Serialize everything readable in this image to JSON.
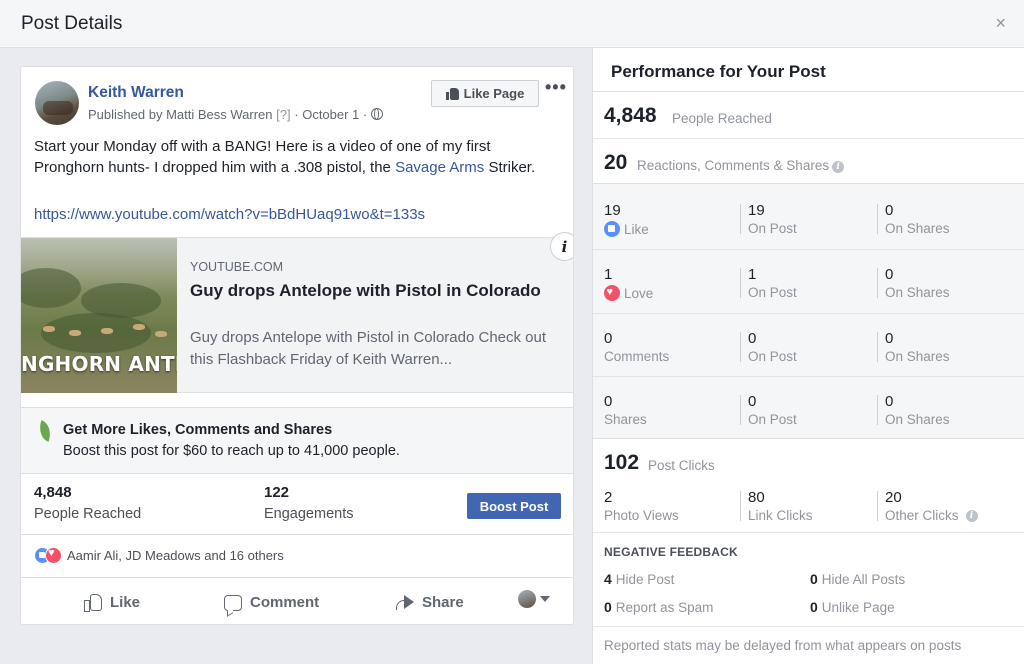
{
  "modal": {
    "title": "Post Details",
    "close_glyph": "×"
  },
  "post": {
    "author": "Keith Warren",
    "published_prefix": "Published by",
    "published_by": "Matti Bess Warren",
    "published_q": "[?]",
    "published_sep": "·",
    "date": "October 1",
    "date_sep": "·",
    "like_page_label": "Like Page",
    "more_glyph": "•••",
    "text_before_link": "Start your Monday off with a BANG! Here is a video of one of my first Pronghorn hunts- I dropped him with a .308 pistol, the ",
    "text_link": "Savage Arms",
    "text_after_link": " Striker.",
    "url": "https://www.youtube.com/watch?v=bBdHUaq91wo&t=133s",
    "preview": {
      "domain": "YOUTUBE.COM",
      "title": "Guy drops Antelope with Pistol in Colorado",
      "description": "Guy drops Antelope with Pistol in Colorado Check out this Flashback Friday of Keith Warren...",
      "image_caption": "NGHORN ANTEL",
      "info_glyph": "i"
    },
    "boost": {
      "title": "Get More Likes, Comments and Shares",
      "subtitle": "Boost this post for $60 to reach up to 41,000 people."
    },
    "stats": {
      "reached_value": "4,848",
      "reached_label": "People Reached",
      "engagements_value": "122",
      "engagements_label": "Engagements",
      "boost_button": "Boost Post"
    },
    "reactions_summary": "Aamir Ali, JD Meadows and 16 others",
    "actions": {
      "like": "Like",
      "comment": "Comment",
      "share": "Share"
    }
  },
  "performance": {
    "title": "Performance for Your Post",
    "reached_value": "4,848",
    "reached_label": "People Reached",
    "reactions_value": "20",
    "reactions_label": "Reactions, Comments & Shares",
    "rows": [
      {
        "c1n": "19",
        "c1l": "Like",
        "c2n": "19",
        "c2l": "On Post",
        "c3n": "0",
        "c3l": "On Shares"
      },
      {
        "c1n": "1",
        "c1l": "Love",
        "c2n": "1",
        "c2l": "On Post",
        "c3n": "0",
        "c3l": "On Shares"
      },
      {
        "c1n": "0",
        "c1l": "Comments",
        "c2n": "0",
        "c2l": "On Post",
        "c3n": "0",
        "c3l": "On Shares"
      },
      {
        "c1n": "0",
        "c1l": "Shares",
        "c2n": "0",
        "c2l": "On Post",
        "c3n": "0",
        "c3l": "On Shares"
      }
    ],
    "clicks_value": "102",
    "clicks_label": "Post Clicks",
    "clicks": [
      {
        "n": "2",
        "l": "Photo Views"
      },
      {
        "n": "80",
        "l": "Link Clicks"
      },
      {
        "n": "20",
        "l": "Other Clicks"
      }
    ],
    "negative_title": "NEGATIVE FEEDBACK",
    "negative": [
      {
        "n": "4",
        "l": "Hide Post"
      },
      {
        "n": "0",
        "l": "Hide All Posts"
      },
      {
        "n": "0",
        "l": "Report as Spam"
      },
      {
        "n": "0",
        "l": "Unlike Page"
      }
    ],
    "footer": "Reported stats may be delayed from what appears on posts"
  },
  "colors": {
    "brand_blue": "#4267b2",
    "link_blue": "#365899",
    "like_blue": "#5890ff",
    "love_red": "#f25268"
  }
}
